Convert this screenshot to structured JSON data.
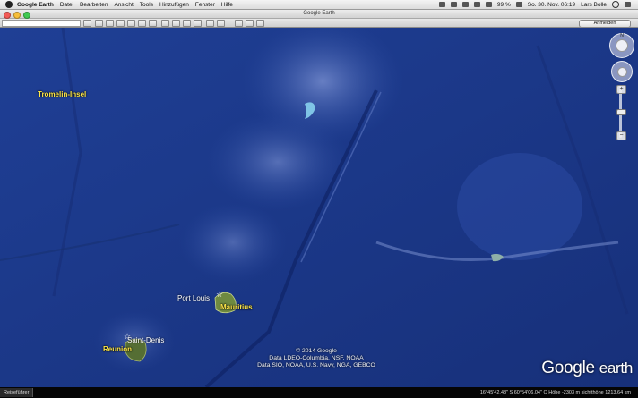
{
  "menubar": {
    "app": "Google Earth",
    "items": [
      "Datei",
      "Bearbeiten",
      "Ansicht",
      "Tools",
      "Hinzufügen",
      "Fenster",
      "Hilfe"
    ],
    "battery": "99 %",
    "datetime": "So. 30. Nov. 06:19",
    "user": "Lars Bolle"
  },
  "window": {
    "title": "Google Earth"
  },
  "toolbar": {
    "signin_label": "Anmelden"
  },
  "map": {
    "labels": {
      "tromelin": "Tromelin-Insel",
      "mauritius": "Mauritius",
      "reunion": "Reunion",
      "port_louis": "Port Louis",
      "saint_denis": "Saint-Denis"
    },
    "copyright": [
      "© 2014 Google",
      "Data LDEO-Columbia, NSF, NOAA",
      "Data SIO, NOAA, U.S. Navy, NGA, GEBCO"
    ],
    "logo_google": "Google",
    "logo_earth": "earth",
    "north_label": "N"
  },
  "statusbar": {
    "guide": "Reiseführer",
    "coords": "16°45'42.48\" S   60°54'06.04\" O   Höhe -2303 m   sichtthöhe 1213.64 km"
  },
  "colors": {
    "ocean": "#1a3b8e",
    "label": "#ffe94a",
    "menubar": "#e8e8e8"
  }
}
